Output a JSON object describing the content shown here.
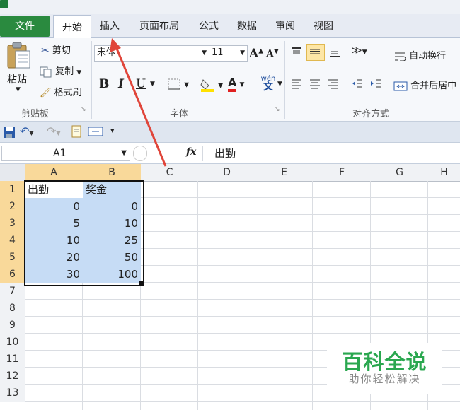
{
  "tabs": {
    "file": "文件",
    "home": "开始",
    "insert": "插入",
    "page_layout": "页面布局",
    "formulas": "公式",
    "data": "数据",
    "review": "审阅",
    "view": "视图"
  },
  "ribbon": {
    "clipboard": {
      "label": "剪贴板",
      "paste": "粘贴",
      "cut": "剪切",
      "copy": "复制",
      "format_painter": "格式刷"
    },
    "font": {
      "label": "字体",
      "font_name": "宋体",
      "font_size": "11",
      "bold": "B",
      "italic": "I",
      "underline": "U",
      "grow": "A",
      "shrink": "A",
      "font_color": "A",
      "phonetic": "wén"
    },
    "alignment": {
      "label": "对齐方式",
      "wrap_text": "自动换行",
      "merge_center": "合并后居中"
    }
  },
  "formula_bar": {
    "cell_ref": "A1",
    "fx": "fx",
    "content": "出勤"
  },
  "sheet": {
    "columns": [
      "A",
      "B",
      "C",
      "D",
      "E",
      "F",
      "G",
      "H"
    ],
    "rows": [
      "1",
      "2",
      "3",
      "4",
      "5",
      "6",
      "7",
      "8",
      "9",
      "10",
      "11",
      "12",
      "13"
    ],
    "data": [
      [
        "出勤",
        "奖金"
      ],
      [
        "0",
        "0"
      ],
      [
        "5",
        "10"
      ],
      [
        "10",
        "25"
      ],
      [
        "20",
        "50"
      ],
      [
        "30",
        "100"
      ]
    ]
  },
  "watermark": {
    "title": "百科全说",
    "subtitle": "助你轻松解决"
  },
  "colors": {
    "file_tab": "#2a8a3f",
    "selection": "#c6dcf5",
    "header_selected": "#f9d99a",
    "arrow": "#e0453a",
    "watermark": "#2aa74f"
  }
}
